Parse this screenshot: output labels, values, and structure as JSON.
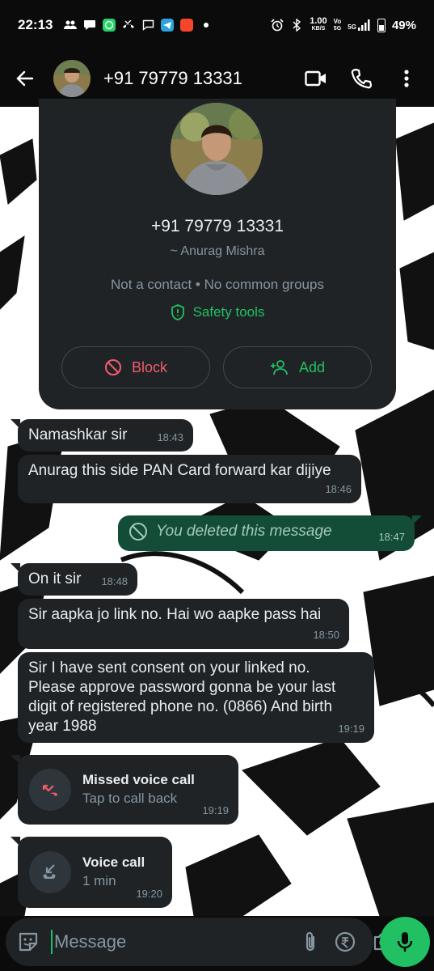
{
  "status_bar": {
    "time": "22:13",
    "net_speed_value": "1.00",
    "net_speed_unit": "KB/S",
    "volte": "Vo",
    "volte_sub": "5G",
    "net_type": "5G",
    "battery": "49%"
  },
  "header": {
    "title": "+91 79779 13331",
    "avatar_icon": "profile-photo"
  },
  "info_card": {
    "phone": "+91 79779 13331",
    "name": "~ Anurag Mishra",
    "note": "Not a contact • No common groups",
    "safety_label": "Safety tools",
    "block_label": "Block",
    "add_label": "Add"
  },
  "messages": [
    {
      "text": "Namashkar  sir",
      "time": "18:43",
      "direction": "in"
    },
    {
      "text": "Anurag this side PAN Card forward kar dijiye",
      "time": "18:46",
      "direction": "in"
    },
    {
      "text": "You deleted this message",
      "time": "18:47",
      "direction": "out",
      "deleted": true
    },
    {
      "text": "On it sir",
      "time": "18:48",
      "direction": "in"
    },
    {
      "text": "Sir aapka jo link no. Hai wo aapke pass hai",
      "time": "18:50",
      "direction": "in"
    },
    {
      "text": "Sir I have sent consent on your linked no. Please approve password gonna be your last digit of registered phone no. (0866) And birth year 1988",
      "time": "19:19",
      "direction": "in"
    }
  ],
  "calls": [
    {
      "title": "Missed voice call",
      "subtitle": "Tap to call back",
      "time": "19:19",
      "missed": true
    },
    {
      "title": "Voice call",
      "subtitle": "1 min",
      "time": "19:20",
      "missed": false
    }
  ],
  "composer": {
    "placeholder": "Message"
  },
  "colors": {
    "accent": "#21c063",
    "danger": "#f15c6d",
    "bubble_in": "#1f2326",
    "bubble_out": "#134d37",
    "bar": "#0b0b0b"
  }
}
